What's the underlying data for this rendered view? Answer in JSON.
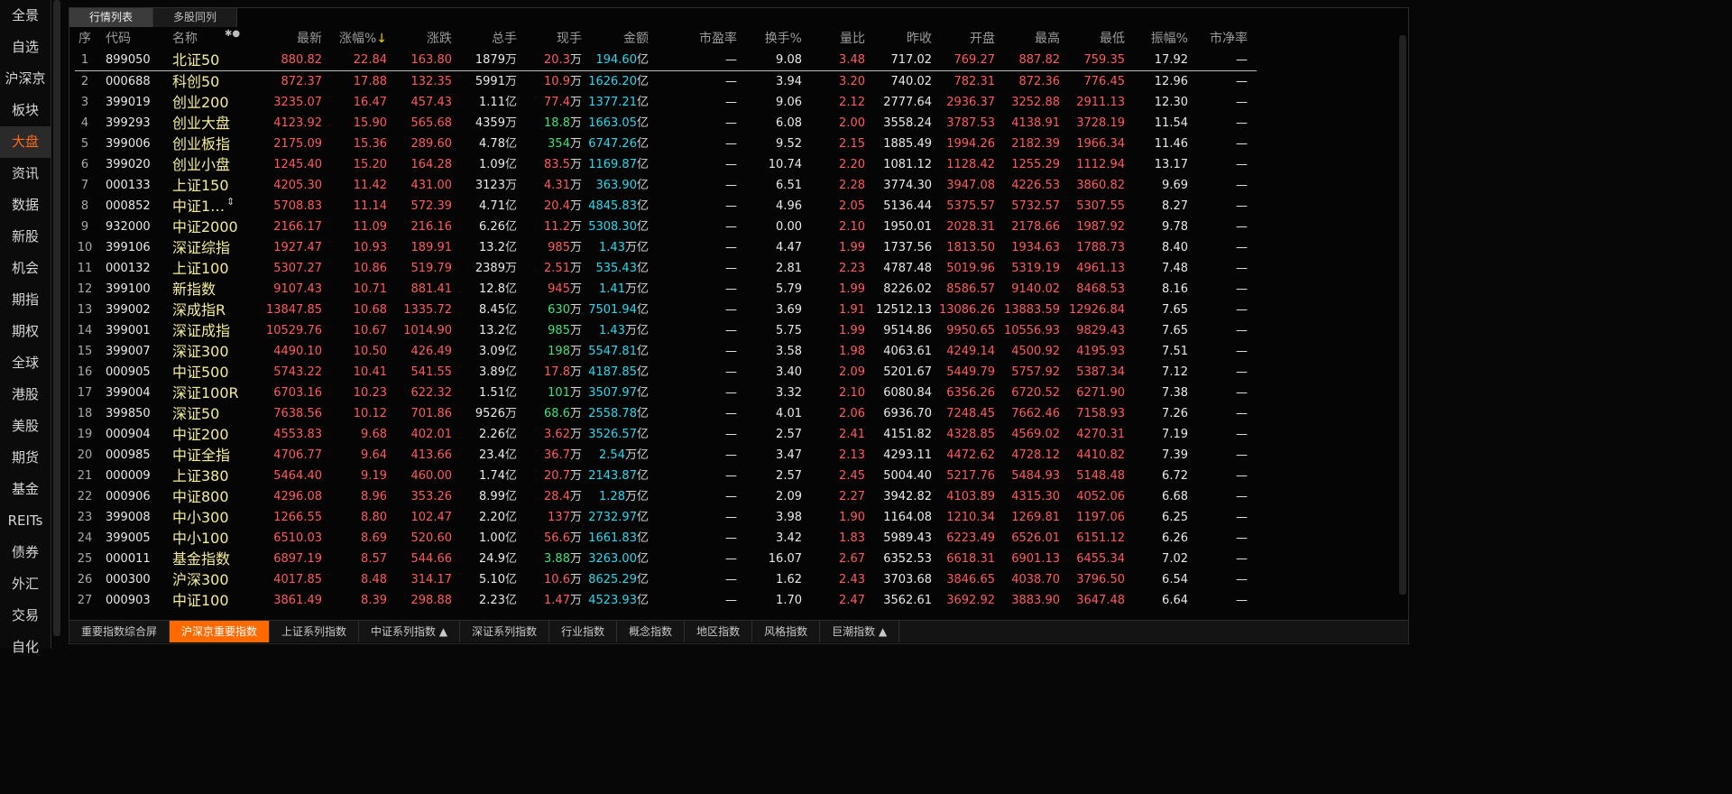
{
  "sidebar": {
    "items": [
      "全景",
      "自选",
      "沪深京",
      "板块",
      "大盘",
      "资讯",
      "数据",
      "新股",
      "机会",
      "期指",
      "期权",
      "全球",
      "港股",
      "美股",
      "期货",
      "基金",
      "REITs",
      "债券",
      "外汇",
      "交易",
      "自化"
    ],
    "active_index": 4
  },
  "top_tabs": [
    "行情列表",
    "多股同列"
  ],
  "sort_arrow": "↓",
  "columns": {
    "seq": "序",
    "code": "代码",
    "name": "名称",
    "name_icons": "✱●",
    "latest": "最新",
    "chg_pct": "涨幅%",
    "chg": "涨跌",
    "vol": "总手",
    "cur": "现手",
    "amount": "金额",
    "pe": "市盈率",
    "turnover": "换手%",
    "vol_ratio": "量比",
    "prev": "昨收",
    "open": "开盘",
    "high": "最高",
    "low": "最低",
    "amp": "振幅%",
    "pb": "市净率"
  },
  "rows": [
    {
      "seq": "1",
      "code": "899050",
      "name": "北证50",
      "latest": "880.82",
      "chg_pct": "22.84",
      "chg": "163.80",
      "vol": "1879",
      "vol_unit": "万",
      "cur": "20.3",
      "cur_unit": "万",
      "cur_color": "red",
      "amt": "194.60",
      "amt_unit": "亿",
      "pe": "—",
      "turnover": "9.08",
      "ratio": "3.48",
      "prev": "717.02",
      "open": "769.27",
      "high": "887.82",
      "low": "759.35",
      "amp": "17.92",
      "pb": "—"
    },
    {
      "seq": "2",
      "code": "000688",
      "name": "科创50",
      "latest": "872.37",
      "chg_pct": "17.88",
      "chg": "132.35",
      "vol": "5991",
      "vol_unit": "万",
      "cur": "10.9",
      "cur_unit": "万",
      "cur_color": "red",
      "amt": "1626.20",
      "amt_unit": "亿",
      "pe": "—",
      "turnover": "3.94",
      "ratio": "3.20",
      "prev": "740.02",
      "open": "782.31",
      "high": "872.36",
      "low": "776.45",
      "amp": "12.96",
      "pb": "—"
    },
    {
      "seq": "3",
      "code": "399019",
      "name": "创业200",
      "latest": "3235.07",
      "chg_pct": "16.47",
      "chg": "457.43",
      "vol": "1.11",
      "vol_unit": "亿",
      "cur": "77.4",
      "cur_unit": "万",
      "cur_color": "red",
      "amt": "1377.21",
      "amt_unit": "亿",
      "pe": "—",
      "turnover": "9.06",
      "ratio": "2.12",
      "prev": "2777.64",
      "open": "2936.37",
      "high": "3252.88",
      "low": "2911.13",
      "amp": "12.30",
      "pb": "—"
    },
    {
      "seq": "4",
      "code": "399293",
      "name": "创业大盘",
      "latest": "4123.92",
      "chg_pct": "15.90",
      "chg": "565.68",
      "vol": "4359",
      "vol_unit": "万",
      "cur": "18.8",
      "cur_unit": "万",
      "cur_color": "green",
      "amt": "1663.05",
      "amt_unit": "亿",
      "pe": "—",
      "turnover": "6.08",
      "ratio": "2.00",
      "prev": "3558.24",
      "open": "3787.53",
      "high": "4138.91",
      "low": "3728.19",
      "amp": "11.54",
      "pb": "—"
    },
    {
      "seq": "5",
      "code": "399006",
      "name": "创业板指",
      "latest": "2175.09",
      "chg_pct": "15.36",
      "chg": "289.60",
      "vol": "4.78",
      "vol_unit": "亿",
      "cur": "354",
      "cur_unit": "万",
      "cur_color": "green",
      "amt": "6747.26",
      "amt_unit": "亿",
      "pe": "—",
      "turnover": "9.52",
      "ratio": "2.15",
      "prev": "1885.49",
      "open": "1994.26",
      "high": "2182.39",
      "low": "1966.34",
      "amp": "11.46",
      "pb": "—"
    },
    {
      "seq": "6",
      "code": "399020",
      "name": "创业小盘",
      "latest": "1245.40",
      "chg_pct": "15.20",
      "chg": "164.28",
      "vol": "1.09",
      "vol_unit": "亿",
      "cur": "83.5",
      "cur_unit": "万",
      "cur_color": "red",
      "amt": "1169.87",
      "amt_unit": "亿",
      "pe": "—",
      "turnover": "10.74",
      "ratio": "2.20",
      "prev": "1081.12",
      "open": "1128.42",
      "high": "1255.29",
      "low": "1112.94",
      "amp": "13.17",
      "pb": "—"
    },
    {
      "seq": "7",
      "code": "000133",
      "name": "上证150",
      "latest": "4205.30",
      "chg_pct": "11.42",
      "chg": "431.00",
      "vol": "3123",
      "vol_unit": "万",
      "cur": "4.31",
      "cur_unit": "万",
      "cur_color": "red",
      "amt": "363.90",
      "amt_unit": "亿",
      "pe": "—",
      "turnover": "6.51",
      "ratio": "2.28",
      "prev": "3774.30",
      "open": "3947.08",
      "high": "4226.53",
      "low": "3860.82",
      "amp": "9.69",
      "pb": "—"
    },
    {
      "seq": "8",
      "code": "000852",
      "name": "中证1…",
      "latest": "5708.83",
      "chg_pct": "11.14",
      "chg": "572.39",
      "vol": "4.71",
      "vol_unit": "亿",
      "cur": "20.4",
      "cur_unit": "万",
      "cur_color": "red",
      "amt": "4845.83",
      "amt_unit": "亿",
      "pe": "—",
      "turnover": "4.96",
      "ratio": "2.05",
      "prev": "5136.44",
      "open": "5375.57",
      "high": "5732.57",
      "low": "5307.55",
      "amp": "8.27",
      "pb": "—",
      "name_mark": "⇕"
    },
    {
      "seq": "9",
      "code": "932000",
      "name": "中证2000",
      "latest": "2166.17",
      "chg_pct": "11.09",
      "chg": "216.16",
      "vol": "6.26",
      "vol_unit": "亿",
      "cur": "11.2",
      "cur_unit": "万",
      "cur_color": "red",
      "amt": "5308.30",
      "amt_unit": "亿",
      "pe": "—",
      "turnover": "0.00",
      "ratio": "2.10",
      "prev": "1950.01",
      "open": "2028.31",
      "high": "2178.66",
      "low": "1987.92",
      "amp": "9.78",
      "pb": "—"
    },
    {
      "seq": "10",
      "code": "399106",
      "name": "深证综指",
      "latest": "1927.47",
      "chg_pct": "10.93",
      "chg": "189.91",
      "vol": "13.2",
      "vol_unit": "亿",
      "cur": "985",
      "cur_unit": "万",
      "cur_color": "red",
      "amt": "1.43",
      "amt_unit": "万亿",
      "pe": "—",
      "turnover": "4.47",
      "ratio": "1.99",
      "prev": "1737.56",
      "open": "1813.50",
      "high": "1934.63",
      "low": "1788.73",
      "amp": "8.40",
      "pb": "—"
    },
    {
      "seq": "11",
      "code": "000132",
      "name": "上证100",
      "latest": "5307.27",
      "chg_pct": "10.86",
      "chg": "519.79",
      "vol": "2389",
      "vol_unit": "万",
      "cur": "2.51",
      "cur_unit": "万",
      "cur_color": "red",
      "amt": "535.43",
      "amt_unit": "亿",
      "pe": "—",
      "turnover": "2.81",
      "ratio": "2.23",
      "prev": "4787.48",
      "open": "5019.96",
      "high": "5319.19",
      "low": "4961.13",
      "amp": "7.48",
      "pb": "—"
    },
    {
      "seq": "12",
      "code": "399100",
      "name": "新指数",
      "latest": "9107.43",
      "chg_pct": "10.71",
      "chg": "881.41",
      "vol": "12.8",
      "vol_unit": "亿",
      "cur": "945",
      "cur_unit": "万",
      "cur_color": "red",
      "amt": "1.41",
      "amt_unit": "万亿",
      "pe": "—",
      "turnover": "5.79",
      "ratio": "1.99",
      "prev": "8226.02",
      "open": "8586.57",
      "high": "9140.02",
      "low": "8468.53",
      "amp": "8.16",
      "pb": "—"
    },
    {
      "seq": "13",
      "code": "399002",
      "name": "深成指R",
      "latest": "13847.85",
      "chg_pct": "10.68",
      "chg": "1335.72",
      "vol": "8.45",
      "vol_unit": "亿",
      "cur": "630",
      "cur_unit": "万",
      "cur_color": "green",
      "amt": "7501.94",
      "amt_unit": "亿",
      "pe": "—",
      "turnover": "3.69",
      "ratio": "1.91",
      "prev": "12512.13",
      "open": "13086.26",
      "high": "13883.59",
      "low": "12926.84",
      "amp": "7.65",
      "pb": "—"
    },
    {
      "seq": "14",
      "code": "399001",
      "name": "深证成指",
      "latest": "10529.76",
      "chg_pct": "10.67",
      "chg": "1014.90",
      "vol": "13.2",
      "vol_unit": "亿",
      "cur": "985",
      "cur_unit": "万",
      "cur_color": "green",
      "amt": "1.43",
      "amt_unit": "万亿",
      "pe": "—",
      "turnover": "5.75",
      "ratio": "1.99",
      "prev": "9514.86",
      "open": "9950.65",
      "high": "10556.93",
      "low": "9829.43",
      "amp": "7.65",
      "pb": "—"
    },
    {
      "seq": "15",
      "code": "399007",
      "name": "深证300",
      "latest": "4490.10",
      "chg_pct": "10.50",
      "chg": "426.49",
      "vol": "3.09",
      "vol_unit": "亿",
      "cur": "198",
      "cur_unit": "万",
      "cur_color": "green",
      "amt": "5547.81",
      "amt_unit": "亿",
      "pe": "—",
      "turnover": "3.58",
      "ratio": "1.98",
      "prev": "4063.61",
      "open": "4249.14",
      "high": "4500.92",
      "low": "4195.93",
      "amp": "7.51",
      "pb": "—"
    },
    {
      "seq": "16",
      "code": "000905",
      "name": "中证500",
      "latest": "5743.22",
      "chg_pct": "10.41",
      "chg": "541.55",
      "vol": "3.89",
      "vol_unit": "亿",
      "cur": "17.8",
      "cur_unit": "万",
      "cur_color": "red",
      "amt": "4187.85",
      "amt_unit": "亿",
      "pe": "—",
      "turnover": "3.40",
      "ratio": "2.09",
      "prev": "5201.67",
      "open": "5449.79",
      "high": "5757.92",
      "low": "5387.34",
      "amp": "7.12",
      "pb": "—"
    },
    {
      "seq": "17",
      "code": "399004",
      "name": "深证100R",
      "latest": "6703.16",
      "chg_pct": "10.23",
      "chg": "622.32",
      "vol": "1.51",
      "vol_unit": "亿",
      "cur": "101",
      "cur_unit": "万",
      "cur_color": "green",
      "amt": "3507.97",
      "amt_unit": "亿",
      "pe": "—",
      "turnover": "3.32",
      "ratio": "2.10",
      "prev": "6080.84",
      "open": "6356.26",
      "high": "6720.52",
      "low": "6271.90",
      "amp": "7.38",
      "pb": "—"
    },
    {
      "seq": "18",
      "code": "399850",
      "name": "深证50",
      "latest": "7638.56",
      "chg_pct": "10.12",
      "chg": "701.86",
      "vol": "9526",
      "vol_unit": "万",
      "cur": "68.6",
      "cur_unit": "万",
      "cur_color": "green",
      "amt": "2558.78",
      "amt_unit": "亿",
      "pe": "—",
      "turnover": "4.01",
      "ratio": "2.06",
      "prev": "6936.70",
      "open": "7248.45",
      "high": "7662.46",
      "low": "7158.93",
      "amp": "7.26",
      "pb": "—"
    },
    {
      "seq": "19",
      "code": "000904",
      "name": "中证200",
      "latest": "4553.83",
      "chg_pct": "9.68",
      "chg": "402.01",
      "vol": "2.26",
      "vol_unit": "亿",
      "cur": "3.62",
      "cur_unit": "万",
      "cur_color": "red",
      "amt": "3526.57",
      "amt_unit": "亿",
      "pe": "—",
      "turnover": "2.57",
      "ratio": "2.41",
      "prev": "4151.82",
      "open": "4328.85",
      "high": "4569.02",
      "low": "4270.31",
      "amp": "7.19",
      "pb": "—"
    },
    {
      "seq": "20",
      "code": "000985",
      "name": "中证全指",
      "latest": "4706.77",
      "chg_pct": "9.64",
      "chg": "413.66",
      "vol": "23.4",
      "vol_unit": "亿",
      "cur": "36.7",
      "cur_unit": "万",
      "cur_color": "red",
      "amt": "2.54",
      "amt_unit": "万亿",
      "pe": "—",
      "turnover": "3.47",
      "ratio": "2.13",
      "prev": "4293.11",
      "open": "4472.62",
      "high": "4728.12",
      "low": "4410.82",
      "amp": "7.39",
      "pb": "—"
    },
    {
      "seq": "21",
      "code": "000009",
      "name": "上证380",
      "latest": "5464.40",
      "chg_pct": "9.19",
      "chg": "460.00",
      "vol": "1.74",
      "vol_unit": "亿",
      "cur": "20.7",
      "cur_unit": "万",
      "cur_color": "red",
      "amt": "2143.87",
      "amt_unit": "亿",
      "pe": "—",
      "turnover": "2.57",
      "ratio": "2.45",
      "prev": "5004.40",
      "open": "5217.76",
      "high": "5484.93",
      "low": "5148.48",
      "amp": "6.72",
      "pb": "—"
    },
    {
      "seq": "22",
      "code": "000906",
      "name": "中证800",
      "latest": "4296.08",
      "chg_pct": "8.96",
      "chg": "353.26",
      "vol": "8.99",
      "vol_unit": "亿",
      "cur": "28.4",
      "cur_unit": "万",
      "cur_color": "red",
      "amt": "1.28",
      "amt_unit": "万亿",
      "pe": "—",
      "turnover": "2.09",
      "ratio": "2.27",
      "prev": "3942.82",
      "open": "4103.89",
      "high": "4315.30",
      "low": "4052.06",
      "amp": "6.68",
      "pb": "—"
    },
    {
      "seq": "23",
      "code": "399008",
      "name": "中小300",
      "latest": "1266.55",
      "chg_pct": "8.80",
      "chg": "102.47",
      "vol": "2.20",
      "vol_unit": "亿",
      "cur": "137",
      "cur_unit": "万",
      "cur_color": "red",
      "amt": "2732.97",
      "amt_unit": "亿",
      "pe": "—",
      "turnover": "3.98",
      "ratio": "1.90",
      "prev": "1164.08",
      "open": "1210.34",
      "high": "1269.81",
      "low": "1197.06",
      "amp": "6.25",
      "pb": "—"
    },
    {
      "seq": "24",
      "code": "399005",
      "name": "中小100",
      "latest": "6510.03",
      "chg_pct": "8.69",
      "chg": "520.60",
      "vol": "1.00",
      "vol_unit": "亿",
      "cur": "56.6",
      "cur_unit": "万",
      "cur_color": "red",
      "amt": "1661.83",
      "amt_unit": "亿",
      "pe": "—",
      "turnover": "3.42",
      "ratio": "1.83",
      "prev": "5989.43",
      "open": "6223.49",
      "high": "6526.01",
      "low": "6151.12",
      "amp": "6.26",
      "pb": "—"
    },
    {
      "seq": "25",
      "code": "000011",
      "name": "基金指数",
      "latest": "6897.19",
      "chg_pct": "8.57",
      "chg": "544.66",
      "vol": "24.9",
      "vol_unit": "亿",
      "cur": "3.88",
      "cur_unit": "万",
      "cur_color": "green",
      "amt": "3263.00",
      "amt_unit": "亿",
      "pe": "—",
      "turnover": "16.07",
      "ratio": "2.67",
      "prev": "6352.53",
      "open": "6618.31",
      "high": "6901.13",
      "low": "6455.34",
      "amp": "7.02",
      "pb": "—"
    },
    {
      "seq": "26",
      "code": "000300",
      "name": "沪深300",
      "latest": "4017.85",
      "chg_pct": "8.48",
      "chg": "314.17",
      "vol": "5.10",
      "vol_unit": "亿",
      "cur": "10.6",
      "cur_unit": "万",
      "cur_color": "red",
      "amt": "8625.29",
      "amt_unit": "亿",
      "pe": "—",
      "turnover": "1.62",
      "ratio": "2.43",
      "prev": "3703.68",
      "open": "3846.65",
      "high": "4038.70",
      "low": "3796.50",
      "amp": "6.54",
      "pb": "—"
    },
    {
      "seq": "27",
      "code": "000903",
      "name": "中证100",
      "latest": "3861.49",
      "chg_pct": "8.39",
      "chg": "298.88",
      "vol": "2.23",
      "vol_unit": "亿",
      "cur": "1.47",
      "cur_unit": "万",
      "cur_color": "red",
      "amt": "4523.93",
      "amt_unit": "亿",
      "pe": "—",
      "turnover": "1.70",
      "ratio": "2.47",
      "prev": "3562.61",
      "open": "3692.92",
      "high": "3883.90",
      "low": "3647.48",
      "amp": "6.64",
      "pb": "—"
    }
  ],
  "bottom_tabs": [
    "重要指数综合屏",
    "沪深京重要指数",
    "上证系列指数",
    "中证系列指数 ▲",
    "深证系列指数",
    "行业指数",
    "概念指数",
    "地区指数",
    "风格指数",
    "巨潮指数 ▲"
  ],
  "bottom_active_index": 1
}
